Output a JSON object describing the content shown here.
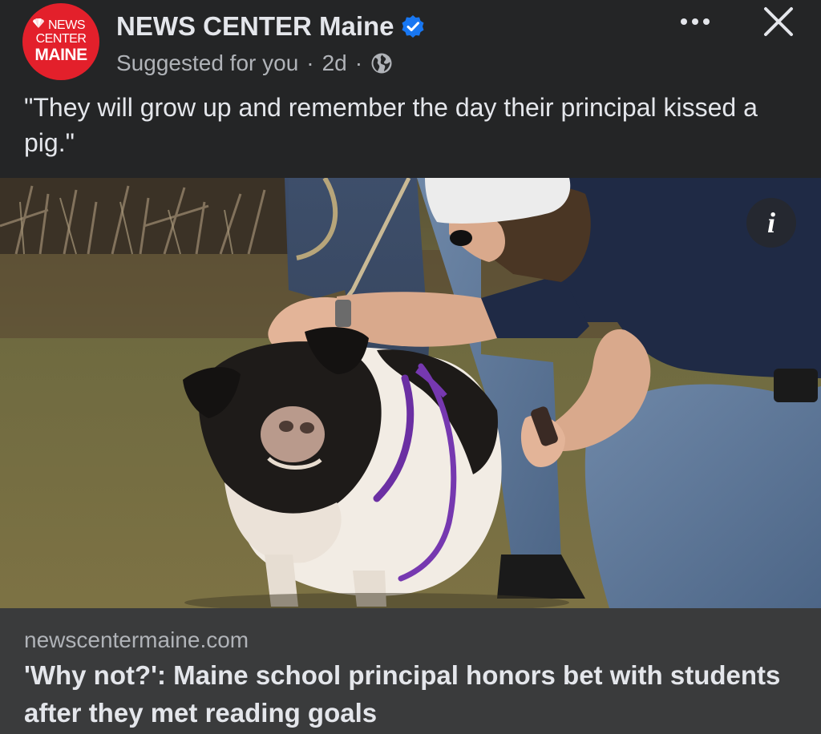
{
  "post": {
    "page_name": "NEWS CENTER Maine",
    "verified_icon": "verified-badge-icon",
    "meta": {
      "suggested": "Suggested for you",
      "separator": "·",
      "age": "2d",
      "audience_icon": "globe-icon"
    },
    "avatar_logo": {
      "line1": "NEWS",
      "line2": "CENTER",
      "line3": "MAINE"
    },
    "caption": "\"They will grow up and remember the day their principal kissed a pig.\"",
    "menu_icon": "more-horizontal-icon",
    "close_icon": "close-icon"
  },
  "photo": {
    "info_label": "i"
  },
  "link": {
    "domain": "newscentermaine.com",
    "title": "'Why not?': Maine school principal honors bet with students after they met reading goals"
  },
  "colors": {
    "background": "#242526",
    "link_footer": "#3a3b3c",
    "brand_red": "#e3202b",
    "verified_blue": "#1877f2",
    "primary_text": "#e4e6eb",
    "secondary_text": "#b0b3b8"
  }
}
